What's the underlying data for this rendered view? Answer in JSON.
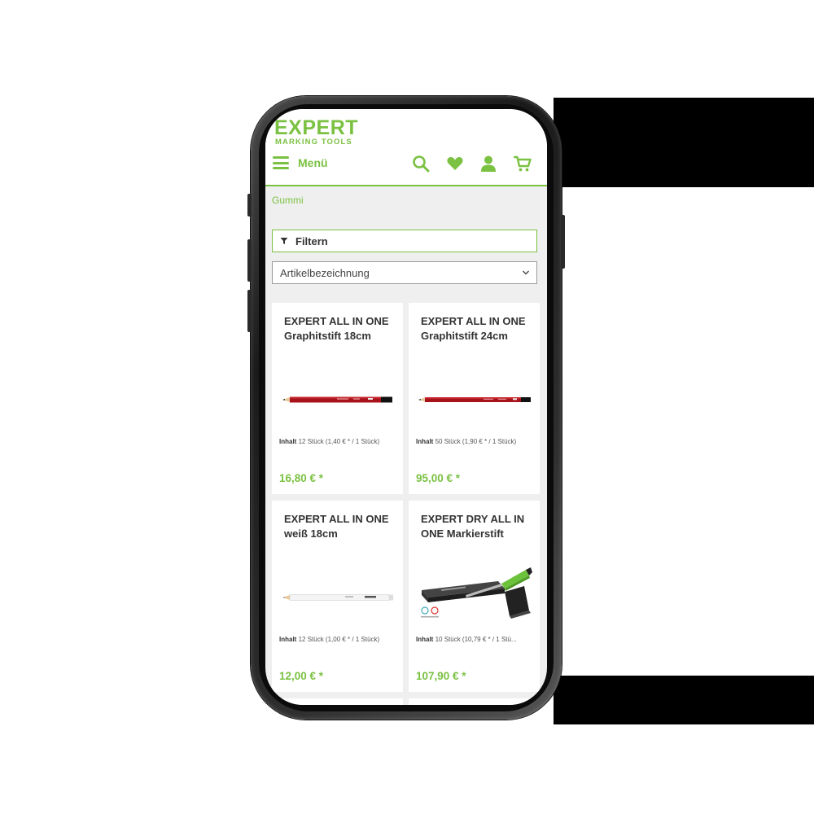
{
  "brand": {
    "name": "EXPERT",
    "tagline": "MARKING TOOLS",
    "accent_color": "#7bc142"
  },
  "header": {
    "menu_label": "Menü",
    "icons": [
      "search-icon",
      "heart-icon",
      "user-icon",
      "cart-icon"
    ]
  },
  "breadcrumb": "Gummi",
  "filter": {
    "label": "Filtern",
    "icon": "funnel-icon"
  },
  "sort": {
    "selected": "Artikelbezeichnung",
    "icon": "chevron-down-icon"
  },
  "products": [
    {
      "title": "EXPERT ALL IN ONE Graphitstift 18cm",
      "content_label": "Inhalt",
      "content_value": "12 Stück (1,40 € * / 1 Stück)",
      "price": "16,80 € *",
      "image": "red-pencil"
    },
    {
      "title": "EXPERT ALL IN ONE Graphitstift 24cm",
      "content_label": "Inhalt",
      "content_value": "50 Stück (1,90 € * / 1 Stück)",
      "price": "95,00 € *",
      "image": "red-pencil-long"
    },
    {
      "title": "EXPERT ALL IN ONE weiß 18cm",
      "content_label": "Inhalt",
      "content_value": "12 Stück (1,00 € * / 1 Stück)",
      "price": "12,00 € *",
      "image": "white-pencil"
    },
    {
      "title": "EXPERT DRY ALL IN ONE Markierstift",
      "content_label": "Inhalt",
      "content_value": "10 Stück (10,79 € * / 1 Stü...",
      "price": "107,90 € *",
      "image": "marker-with-box"
    }
  ]
}
